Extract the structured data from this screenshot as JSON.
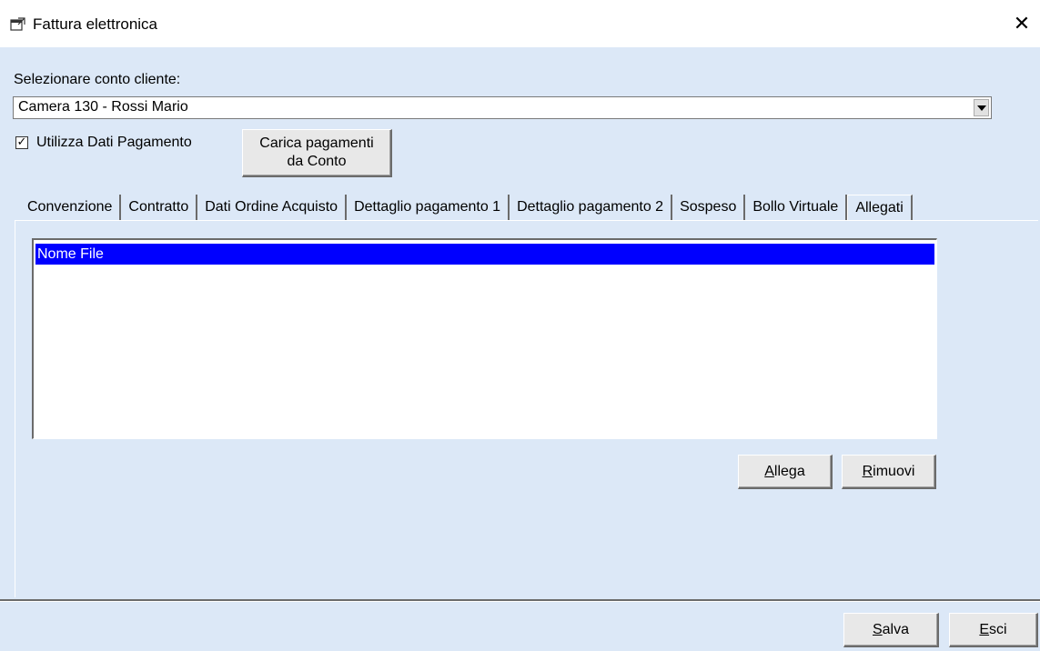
{
  "window": {
    "title": "Fattura elettronica",
    "close_glyph": "✕"
  },
  "account": {
    "label": "Selezionare conto cliente:",
    "selected": "Camera 130 - Rossi Mario"
  },
  "payment": {
    "checkbox_label": "Utilizza Dati Pagamento",
    "checked": true,
    "load_button_line1": "Carica pagamenti",
    "load_button_line2": "da Conto"
  },
  "tabs": [
    {
      "label": "Convenzione"
    },
    {
      "label": "Contratto"
    },
    {
      "label": "Dati Ordine Acquisto"
    },
    {
      "label": "Dettaglio pagamento 1"
    },
    {
      "label": "Dettaglio pagamento 2"
    },
    {
      "label": "Sospeso"
    },
    {
      "label": "Bollo Virtuale"
    },
    {
      "label": "Allegati"
    }
  ],
  "active_tab": "Allegati",
  "attachments": {
    "column_header": "Nome File",
    "rows": [],
    "attach_button": {
      "key": "A",
      "rest": "llega"
    },
    "remove_button": {
      "key": "R",
      "rest": "imuovi"
    }
  },
  "footer": {
    "save_button": {
      "key": "S",
      "rest": "alva"
    },
    "exit_button": {
      "key": "E",
      "rest": "sci"
    }
  },
  "colors": {
    "background": "#dce8f7",
    "selection": "#0000ff"
  }
}
